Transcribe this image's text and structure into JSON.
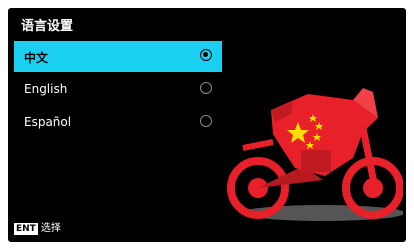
{
  "header": {
    "title": "语言设置"
  },
  "languages": [
    {
      "label": "中文",
      "selected": true
    },
    {
      "label": "English",
      "selected": false
    },
    {
      "label": "Español",
      "selected": false
    }
  ],
  "footer": {
    "key": "ENT",
    "action": "选择"
  },
  "colors": {
    "highlight": "#1ad0f0",
    "background": "#000000",
    "bike": "#e8202a"
  },
  "illustration": "motorcycle-chinese-flag"
}
